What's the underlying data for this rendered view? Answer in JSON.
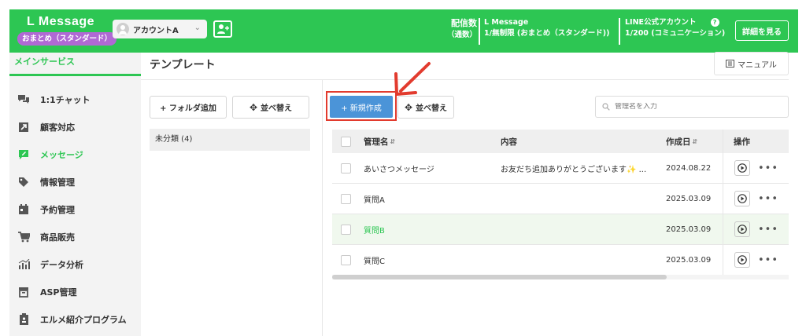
{
  "header": {
    "brand": "L Message",
    "plan_badge": "おまとめ（スタンダード）",
    "account_name": "アカウントA",
    "delivery_label": "配信数",
    "delivery_sub": "（通数）",
    "lmessage_label": "L Message",
    "lmessage_value": "1/無制限 (おまとめ（スタンダード))",
    "line_label": "LINE公式アカウント",
    "line_value": "1/200 (コミュニケーション)",
    "detail_button": "詳細を見る"
  },
  "sidebar": {
    "section_title": "メインサービス",
    "items": [
      {
        "label": "1:1チャット",
        "icon": "chat-bubbles-icon"
      },
      {
        "label": "顧客対応",
        "icon": "customer-arrow-icon"
      },
      {
        "label": "メッセージ",
        "icon": "message-edit-icon"
      },
      {
        "label": "情報管理",
        "icon": "tag-icon"
      },
      {
        "label": "予約管理",
        "icon": "calendar-icon"
      },
      {
        "label": "商品販売",
        "icon": "cart-icon"
      },
      {
        "label": "データ分析",
        "icon": "bar-chart-icon"
      },
      {
        "label": "ASP管理",
        "icon": "asp-box-icon"
      },
      {
        "label": "エルメ紹介プログラム",
        "icon": "clipboard-icon"
      }
    ]
  },
  "main": {
    "title": "テンプレート",
    "manual_button": "マニュアル",
    "folder_add_button": "+ フォルダ追加",
    "folder_sort_button": "並べ替え",
    "folder_row": "未分類 (4)",
    "new_button": "+ 新規作成",
    "sort_button": "並べ替え",
    "search_placeholder": "管理名を入力"
  },
  "table": {
    "headers": {
      "name": "管理名",
      "content": "内容",
      "date": "作成日",
      "ops": "操作"
    },
    "rows": [
      {
        "name": "あいさつメッセージ",
        "content": "お友だち追加ありがとうございます✨ ...",
        "date": "2024.08.22"
      },
      {
        "name": "質問A",
        "content": "",
        "date": "2025.03.09"
      },
      {
        "name": "質問B",
        "content": "",
        "date": "2025.03.09"
      },
      {
        "name": "質問C",
        "content": "",
        "date": "2025.03.09"
      }
    ]
  },
  "colors": {
    "accent": "#2dc653",
    "primary_button": "#4b94d8",
    "badge": "#b069d4",
    "annotation": "#e23b2e"
  }
}
